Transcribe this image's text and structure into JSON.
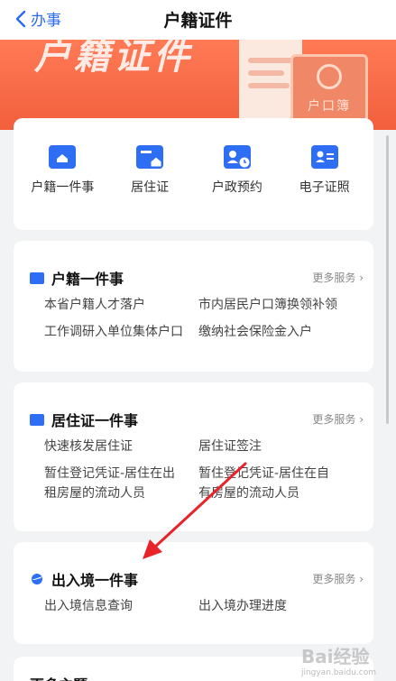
{
  "header": {
    "back_label": "办事",
    "title": "户籍证件"
  },
  "banner": {
    "title": "户籍证件",
    "book_label": "户口簿"
  },
  "quick_actions": [
    {
      "label": "户籍一件事",
      "icon": "household-card-icon"
    },
    {
      "label": "居住证",
      "icon": "residence-permit-icon"
    },
    {
      "label": "户政预约",
      "icon": "appointment-icon"
    },
    {
      "label": "电子证照",
      "icon": "e-license-icon"
    }
  ],
  "sections": [
    {
      "title": "户籍一件事",
      "more": "更多服务 ›",
      "links": [
        "本省户籍人才落户",
        "市内居民户口簿换领补领",
        "工作调研入单位集体户口",
        "缴纳社会保险金入户"
      ]
    },
    {
      "title": "居住证一件事",
      "more": "更多服务 ›",
      "links": [
        "快速核发居住证",
        "居住证签注",
        "暂住登记凭证-居住在出租房屋的流动人员",
        "暂住登记凭证-居住在自有房屋的流动人员"
      ]
    },
    {
      "title": "出入境一件事",
      "more": "更多服务 ›",
      "links": [
        "出入境信息查询",
        "出入境办理进度"
      ]
    }
  ],
  "more_topics": "更多主题",
  "watermark": {
    "brand": "Bai经验",
    "url": "jingyan.baidu.com"
  },
  "colors": {
    "accent": "#2d6ef5",
    "banner": "#f25f3d",
    "arrow": "#e8242a"
  }
}
